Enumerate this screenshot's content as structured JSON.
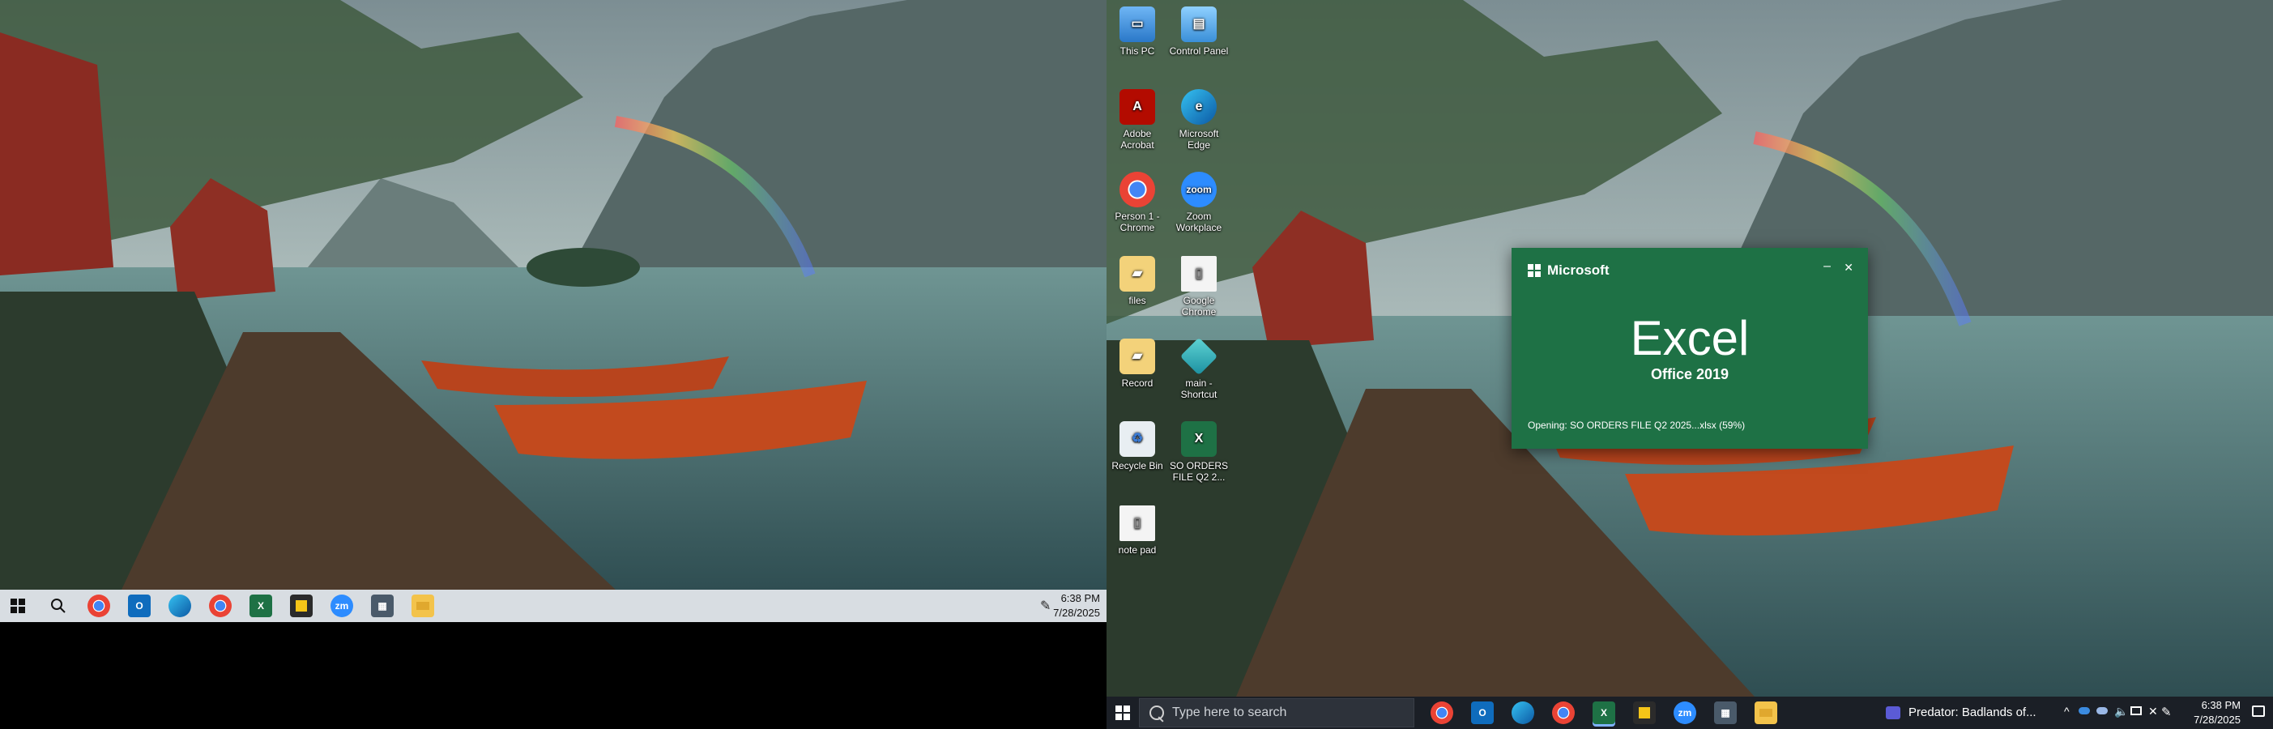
{
  "left_screen": {
    "taskbar": {
      "icons": [
        "windows-start-icon",
        "search-icon",
        "chrome-icon",
        "outlook-icon",
        "edge-icon",
        "chrome-profile-icon",
        "excel-icon",
        "sticky-notes-icon",
        "zoom-icon",
        "calculator-icon",
        "file-explorer-icon"
      ],
      "time": "6:38 PM",
      "date": "7/28/2025"
    }
  },
  "right_screen": {
    "desktop_icons": [
      {
        "label": "This PC",
        "icon": "this-pc-icon"
      },
      {
        "label": "Control Panel",
        "icon": "control-panel-icon"
      },
      {
        "label": "Adobe Acrobat",
        "icon": "adobe-acrobat-icon"
      },
      {
        "label": "Microsoft Edge",
        "icon": "edge-icon"
      },
      {
        "label": "Person 1 - Chrome",
        "icon": "chrome-icon"
      },
      {
        "label": "Zoom Workplace",
        "icon": "zoom-icon"
      },
      {
        "label": "files",
        "icon": "folder-icon"
      },
      {
        "label": "Google Chrome",
        "icon": "file-icon"
      },
      {
        "label": "Record",
        "icon": "folder-icon"
      },
      {
        "label": "main - Shortcut",
        "icon": "shortcut-icon"
      },
      {
        "label": "Recycle Bin",
        "icon": "recycle-bin-icon"
      },
      {
        "label": "SO ORDERS FILE Q2 2...",
        "icon": "excel-file-icon"
      },
      {
        "label": "note pad",
        "icon": "file-icon"
      }
    ],
    "splash": {
      "brand": "Microsoft",
      "app": "Excel",
      "version": "Office 2019",
      "status": "Opening: SO ORDERS FILE Q2 2025...xlsx  (59%)",
      "progress_percent": 59,
      "minimize": "–",
      "close": "✕",
      "color": "#1e7145"
    },
    "taskbar": {
      "search_placeholder": "Type here to search",
      "media_title": "Predator: Badlands of...",
      "tray_chevron": "^",
      "time": "6:38 PM",
      "date": "7/28/2025"
    }
  }
}
